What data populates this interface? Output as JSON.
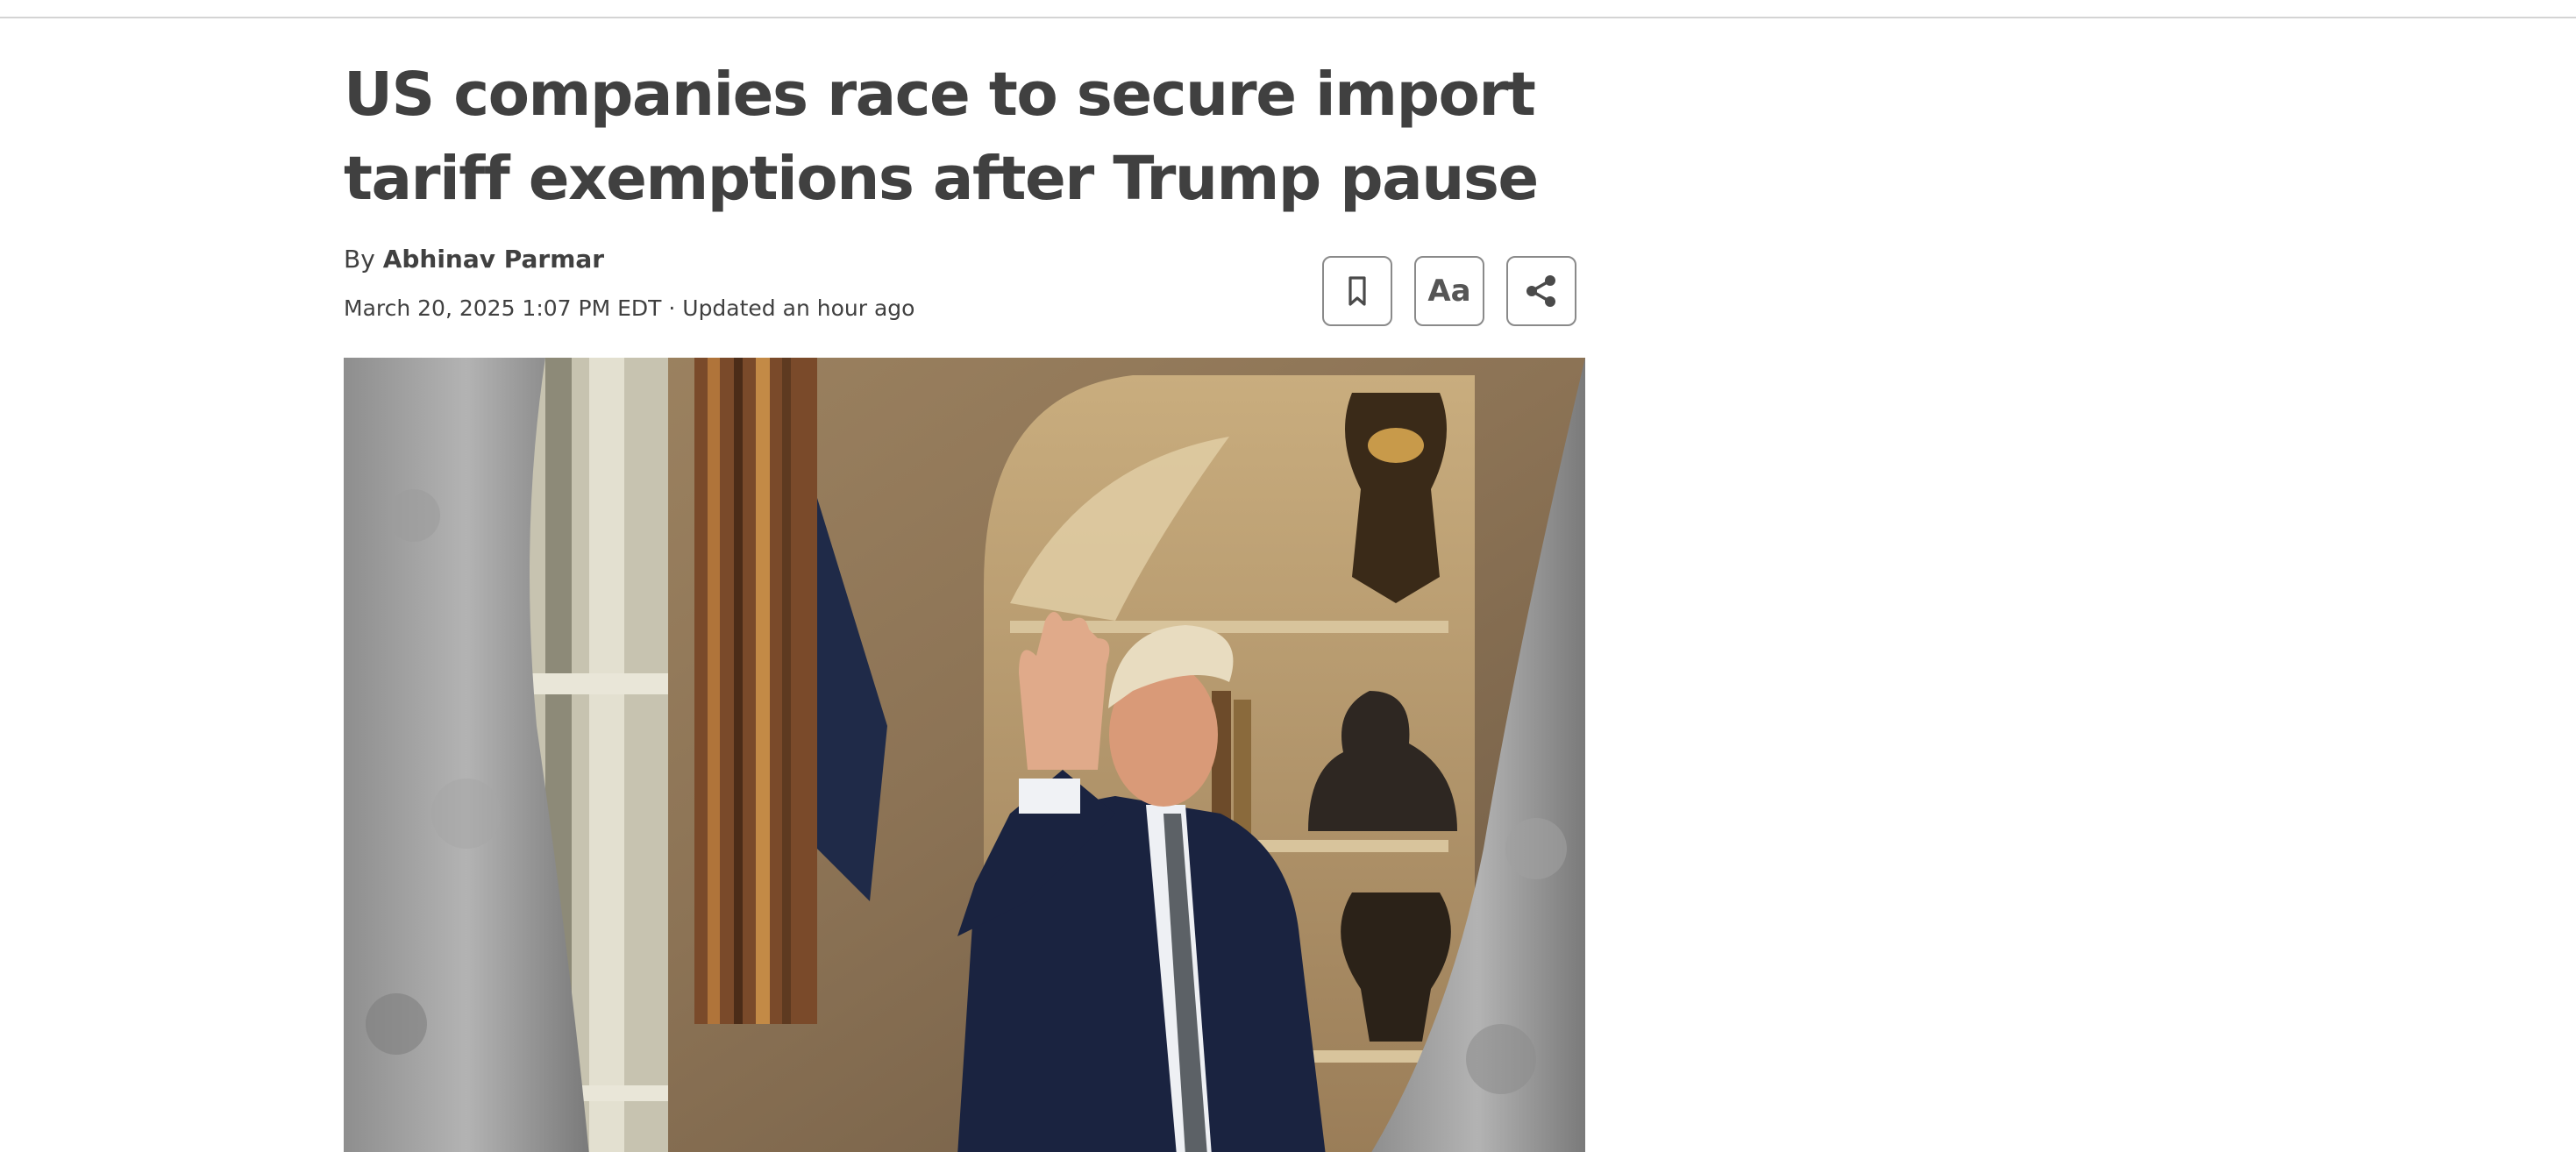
{
  "article": {
    "headline": "US companies race to secure import tariff exemptions after Trump pause",
    "byline_prefix": "By ",
    "author": "Abhinav Parmar",
    "dateline": "March 20, 2025 1:07 PM EDT · Updated an hour ago"
  },
  "toolbar": {
    "bookmark_icon": "bookmark-icon",
    "text_size_label": "Aa",
    "share_icon": "share-icon"
  },
  "colors": {
    "text": "#404040",
    "button_border": "#8a8a8a",
    "rule": "#d4d4d4"
  }
}
